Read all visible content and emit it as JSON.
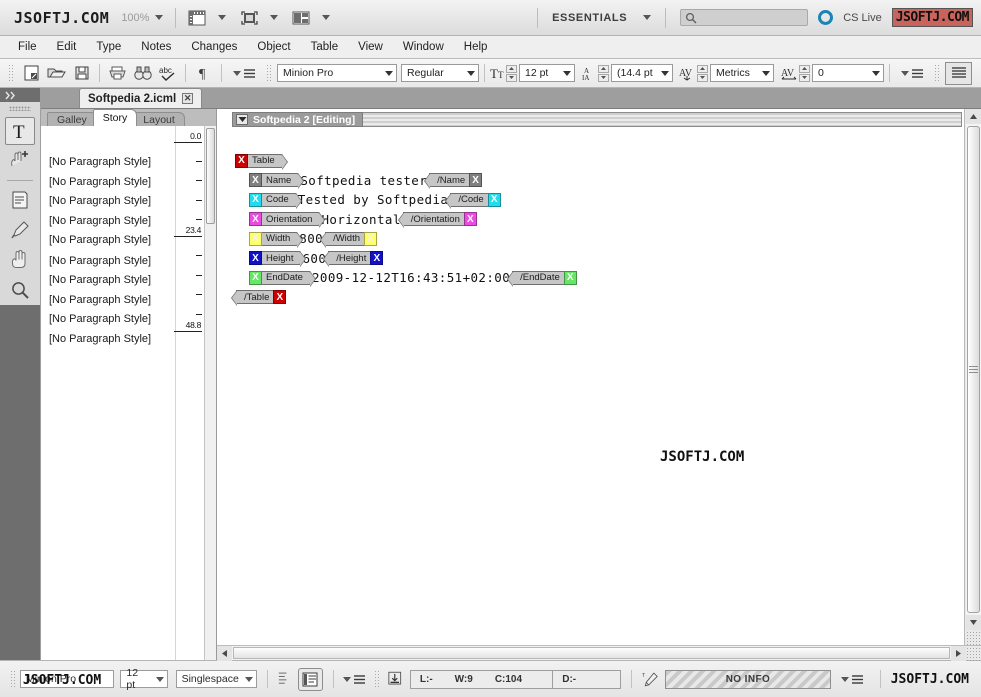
{
  "app": {
    "logo": "JSOFTJ.COM",
    "zoom": "100%",
    "workspace": "ESSENTIALS",
    "search_placeholder": "",
    "cs_live": "CS Live",
    "window_watermark": "JSOFTJ.COM",
    "center_watermark": "JSOFTJ.COM",
    "status_watermark": "JSOFTJ.COM",
    "view_buttons": [
      {
        "name": "view-options-button",
        "icon": "ruler-grid-icon"
      },
      {
        "name": "screen-mode-button",
        "icon": "screen-mode-icon"
      },
      {
        "name": "arrange-documents-button",
        "icon": "arrange-documents-icon"
      }
    ]
  },
  "menu": {
    "items": [
      "File",
      "Edit",
      "Type",
      "Notes",
      "Changes",
      "Object",
      "Table",
      "View",
      "Window",
      "Help"
    ]
  },
  "toolbar": {
    "buttons": [
      {
        "name": "new-document-button",
        "icon": "new-doc-icon"
      },
      {
        "name": "open-document-button",
        "icon": "folder-icon"
      },
      {
        "name": "save-button",
        "icon": "floppy-disk-icon"
      },
      {
        "name": "print-button",
        "icon": "printer-icon"
      },
      {
        "name": "find-change-button",
        "icon": "binoculars-icon"
      },
      {
        "name": "spell-check-button",
        "icon": "abc-check-icon"
      },
      {
        "name": "show-hidden-characters-button",
        "icon": "pilcrow-icon"
      }
    ],
    "font_family": "Minion Pro",
    "font_style": "Regular",
    "font_size": "12 pt",
    "leading": "(14.4 pt",
    "kerning": "Metrics",
    "tracking": "0",
    "paragraph_align_icon": "align-justify-icon"
  },
  "tools": [
    {
      "name": "type-tool",
      "icon": "text-type-icon",
      "selected": true
    },
    {
      "name": "note-tool",
      "icon": "note-hand-icon",
      "selected": false
    },
    {
      "name": "notes-panel-tool",
      "icon": "notes-document-icon",
      "selected": false
    },
    {
      "name": "eyedropper-tool",
      "icon": "eyedropper-icon",
      "selected": false
    },
    {
      "name": "hand-tool",
      "icon": "hand-icon",
      "selected": false
    },
    {
      "name": "zoom-tool",
      "icon": "magnifier-icon",
      "selected": false
    }
  ],
  "document": {
    "tab_title": "Softpedia 2.icml",
    "close_glyph": "✕"
  },
  "view_tabs": [
    {
      "label": "Galley",
      "active": false
    },
    {
      "label": "Story",
      "active": true
    },
    {
      "label": "Layout",
      "active": false
    }
  ],
  "galley": {
    "paragraph_styles": [
      "[No Paragraph Style]",
      "[No Paragraph Style]",
      "[No Paragraph Style]",
      "[No Paragraph Style]",
      "[No Paragraph Style]",
      "[No Paragraph Style]",
      "[No Paragraph Style]",
      "[No Paragraph Style]",
      "[No Paragraph Style]",
      "[No Paragraph Style]"
    ],
    "ruler_labels": [
      "0.0",
      "23.4",
      "48.8"
    ]
  },
  "story": {
    "header_title": "Softpedia 2 [Editing]",
    "root_tag": "Table",
    "root_color": "#cc0000",
    "close_root_tag": "/Table",
    "elements": [
      {
        "tag": "Name",
        "close_tag": "/Name",
        "value": "Softpedia tester",
        "color": "#808080"
      },
      {
        "tag": "Code",
        "close_tag": "/Code",
        "value": "Tested by Softpedia",
        "color": "#22dced"
      },
      {
        "tag": "Orientation",
        "close_tag": "/Orientation",
        "value": "Horizontal",
        "color": "#e94ce0"
      },
      {
        "tag": "Width",
        "close_tag": "/Width",
        "value": "800",
        "color": "#ffff66"
      },
      {
        "tag": "Height",
        "close_tag": "/Height",
        "value": "600",
        "color": "#1111cc"
      },
      {
        "tag": "EndDate",
        "close_tag": "/EndDate",
        "value": "2009-12-12T16:43:51+02:00",
        "color": "#66e566"
      }
    ]
  },
  "statusbar": {
    "font_family": "Minion Pro",
    "font_size": "12 pt",
    "line_spacing": "Singlespace",
    "view_mode_icon": "galley-view-icon",
    "track_changes_icon": "pencil-icon",
    "info": {
      "line": "L:-",
      "words": "W:9",
      "chars": "C:104",
      "depth": "D:-"
    },
    "no_info": "NO INFO"
  }
}
